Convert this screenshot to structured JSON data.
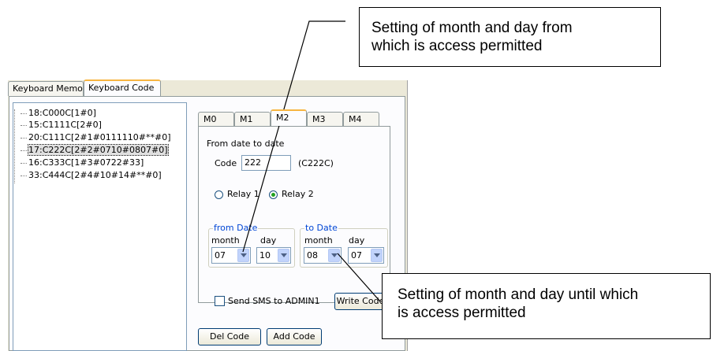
{
  "outer_tabs": [
    "Keyboard Memo",
    "Keyboard Code"
  ],
  "tree_items": [
    "18:C000C[1#0]",
    "15:C1111C[2#0]",
    "20:C111C[2#1#0111110#**#0]",
    "17:C222C[2#2#0710#0807#0]",
    "16:C333C[1#3#0722#33]",
    "33:C444C[2#4#10#14#**#0]"
  ],
  "inner_tabs": [
    "M0",
    "M1",
    "M2",
    "M3",
    "M4"
  ],
  "section_title": "From date to date",
  "code": {
    "label": "Code",
    "value": "222",
    "display": "(C222C)"
  },
  "relays": [
    {
      "label": "Relay 1",
      "selected": false
    },
    {
      "label": "Relay 2",
      "selected": true
    }
  ],
  "from_date": {
    "title": "from Date",
    "month_label": "month",
    "day_label": "day",
    "month": "07",
    "day": "10"
  },
  "to_date": {
    "title": "to Date",
    "month_label": "month",
    "day_label": "day",
    "month": "08",
    "day": "07"
  },
  "sms_checkbox": {
    "label": "Send SMS to ADMIN1",
    "checked": false
  },
  "buttons": {
    "write": "Write Code",
    "del": "Del Code",
    "add": "Add Code"
  },
  "callouts": {
    "top": [
      "Setting of month and day from",
      "which is access permitted"
    ],
    "bottom": [
      "Setting of month and day until which",
      "is access permitted"
    ]
  }
}
